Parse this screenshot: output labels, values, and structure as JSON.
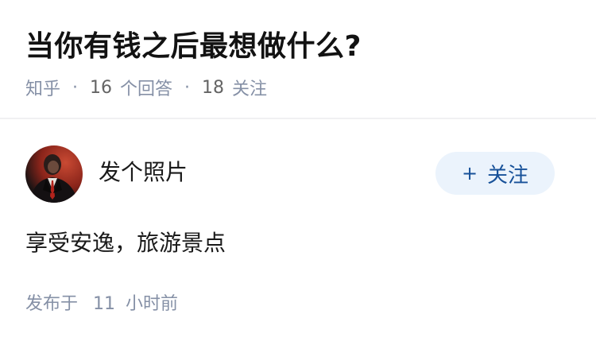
{
  "question": {
    "title": "当你有钱之后最想做什么?",
    "source": "知乎",
    "answer_count": "16",
    "answer_unit": "个回答",
    "follower_count": "18",
    "follower_unit": "关注",
    "separator": "·"
  },
  "answer": {
    "author": {
      "name": "发个照片",
      "avatar_icon": "avatar-portrait-icon"
    },
    "follow_button": {
      "icon": "+",
      "label": "关注"
    },
    "content": "享受安逸，旅游景点",
    "time_label": "发布于",
    "time_number": "11",
    "time_unit": "小时前"
  },
  "colors": {
    "accent": "#175199",
    "follow_bg": "#ebf3fc",
    "meta": "#8590a6",
    "divider": "#f0f0f2"
  }
}
